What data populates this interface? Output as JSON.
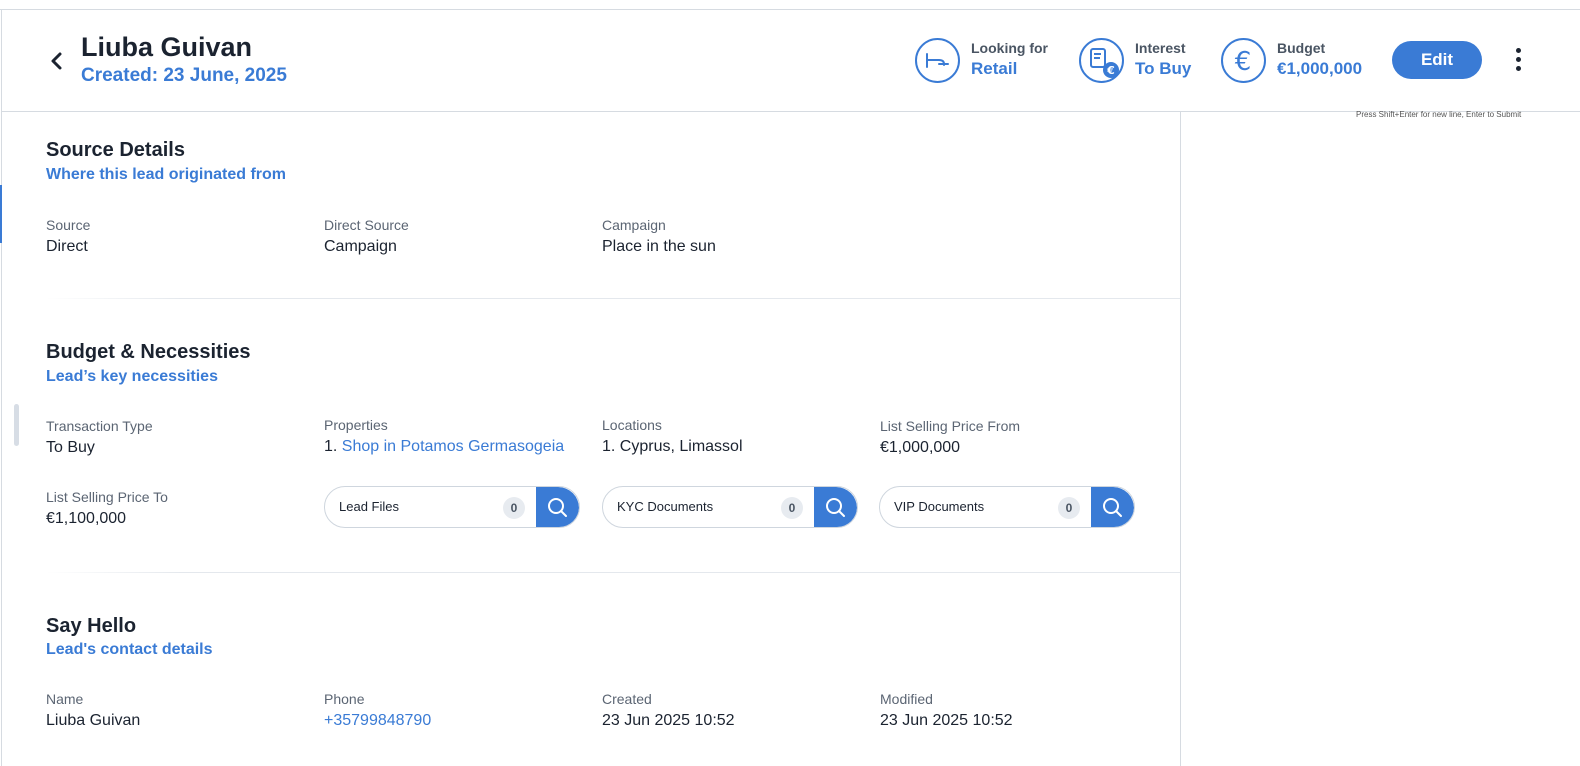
{
  "header": {
    "name": "Liuba Guivan",
    "created_label": "Created:",
    "created_date": "23 June, 2025",
    "stats": {
      "looking_for": {
        "label": "Looking for",
        "value": "Retail",
        "icon": "retail-icon"
      },
      "interest": {
        "label": "Interest",
        "value": "To Buy",
        "icon": "interest-euro-icon"
      },
      "budget": {
        "label": "Budget",
        "value": "€1,000,000",
        "icon": "euro-icon"
      }
    },
    "edit_label": "Edit",
    "hint": "Press Shift+Enter for new line, Enter to Submit"
  },
  "source": {
    "title": "Source Details",
    "subtitle": "Where this lead originated from",
    "fields": [
      {
        "label": "Source",
        "value": "Direct"
      },
      {
        "label": "Direct Source",
        "value": "Campaign"
      },
      {
        "label": "Campaign",
        "value": "Place in the sun"
      }
    ]
  },
  "budget": {
    "title": "Budget & Necessities",
    "subtitle": "Lead’s key necessities",
    "transaction_type": {
      "label": "Transaction Type",
      "value": "To Buy"
    },
    "properties": {
      "label": "Properties",
      "prefix": "1.",
      "value": "Shop in Potamos Germasogeia"
    },
    "locations": {
      "label": "Locations",
      "value": "1. Cyprus, Limassol"
    },
    "price_from": {
      "label": "List Selling Price From",
      "value": "€1,000,000"
    },
    "price_to": {
      "label": "List Selling Price To",
      "value": "€1,100,000"
    },
    "searches": [
      {
        "label": "Lead Files",
        "count": "0"
      },
      {
        "label": "KYC Documents",
        "count": "0"
      },
      {
        "label": "VIP Documents",
        "count": "0"
      }
    ]
  },
  "hello": {
    "title": "Say Hello",
    "subtitle": "Lead's contact details",
    "fields": [
      {
        "label": "Name",
        "value": "Liuba Guivan"
      },
      {
        "label": "Phone",
        "value": "+35799848790"
      },
      {
        "label": "Created",
        "value": "23 Jun 2025 10:52"
      },
      {
        "label": "Modified",
        "value": "23 Jun 2025 10:52"
      }
    ]
  },
  "colors": {
    "accent": "#3a7bd5",
    "text": "#1b2330",
    "muted": "#5b6573"
  }
}
